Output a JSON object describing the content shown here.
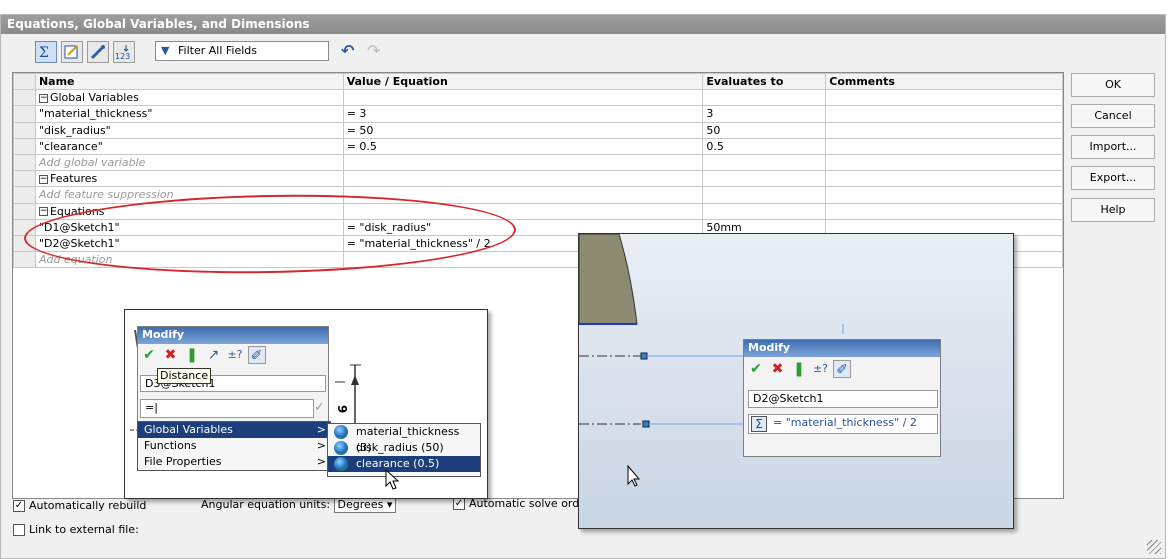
{
  "window": {
    "title": "Equations, Global Variables, and Dimensions"
  },
  "toolbar": {
    "icons": [
      "equation-view-icon",
      "sketch-equation-view-icon",
      "dimension-view-icon",
      "ordered-view-icon"
    ],
    "filter_label": "Filter All Fields",
    "undo_icon": "undo-icon",
    "redo_icon": "redo-icon"
  },
  "grid": {
    "headers": {
      "name": "Name",
      "value": "Value / Equation",
      "evaluates": "Evaluates to",
      "comments": "Comments"
    },
    "global_group": "Global Variables",
    "globals": [
      {
        "name": "\"material_thickness\"",
        "value": "= 3",
        "evaluates": "3"
      },
      {
        "name": "\"disk_radius\"",
        "value": "= 50",
        "evaluates": "50"
      },
      {
        "name": "\"clearance\"",
        "value": "= 0.5",
        "evaluates": "0.5"
      }
    ],
    "add_global": "Add global variable",
    "features_group": "Features",
    "add_feature": "Add feature suppression",
    "equations_group": "Equations",
    "equations": [
      {
        "name": "\"D1@Sketch1\"",
        "value": "= \"disk_radius\"",
        "evaluates": "50mm"
      },
      {
        "name": "\"D2@Sketch1\"",
        "value": "= \"material_thickness\" / 2",
        "evaluates": ""
      }
    ],
    "add_equation": "Add equation"
  },
  "buttons": {
    "ok": "OK",
    "cancel": "Cancel",
    "import": "Import...",
    "export": "Export...",
    "help": "Help"
  },
  "options": {
    "auto_rebuild": "Automatically rebuild",
    "auto_rebuild_checked": true,
    "angular_units_label": "Angular equation units:",
    "angular_units_value": "Degrees",
    "auto_solve": "Automatic solve orde",
    "auto_solve_checked": true,
    "link_external": "Link to external file:",
    "link_external_checked": false
  },
  "modify_left": {
    "title": "Modify",
    "tooltip": "Distance",
    "name_field": "D3@Sketch1",
    "value_field": "=",
    "dim_label": "9",
    "menu": [
      {
        "label": "Global Variables",
        "arrow": ">"
      },
      {
        "label": "Functions",
        "arrow": ">"
      },
      {
        "label": "File Properties",
        "arrow": ">"
      }
    ],
    "submenu": [
      "material_thickness (3)",
      "disk_radius (50)",
      "clearance (0.5)"
    ]
  },
  "modify_right": {
    "title": "Modify",
    "name_field": "D2@Sketch1",
    "value_field": "= \"material_thickness\" / 2"
  },
  "colors": {
    "accent": "#1c3f7a",
    "highlight": "#d7262b",
    "title_grad": "#3d6db0"
  }
}
